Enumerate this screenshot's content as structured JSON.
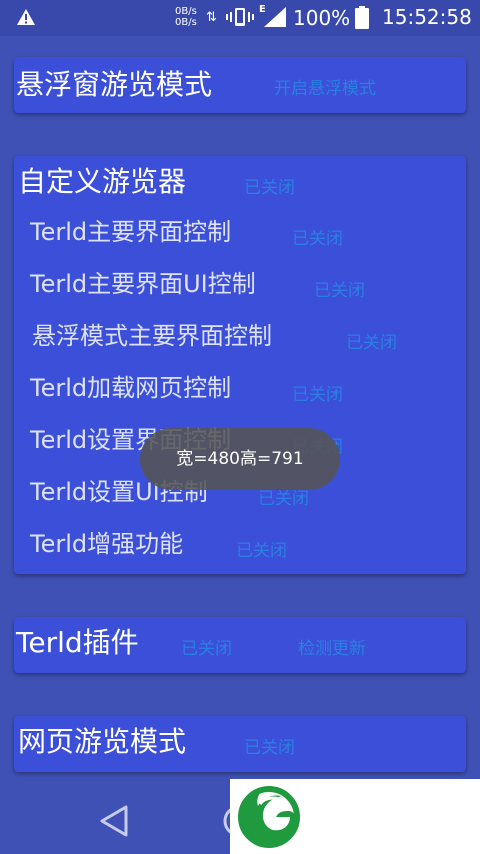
{
  "status_bar": {
    "net_up": "0B/s",
    "net_down": "0B/s",
    "network_type": "E",
    "battery_percent": "100%",
    "time": "15:52:58",
    "icons": [
      "warning-icon",
      "data-arrows-icon",
      "vibrate-icon",
      "signal-icon",
      "battery-icon"
    ]
  },
  "cards": {
    "floating": {
      "title": "悬浮窗游览模式",
      "action": "开启悬浮模式"
    },
    "custom": {
      "title": "自定义游览器",
      "status": "已关闭",
      "items": [
        {
          "label": "Terld主要界面控制",
          "status": "已关闭"
        },
        {
          "label": "Terld主要界面UI控制",
          "status": "已关闭"
        },
        {
          "label": "悬浮模式主要界面控制",
          "status": "已关闭"
        },
        {
          "label": "Terld加载网页控制",
          "status": "已关闭"
        },
        {
          "label": "Terld设置界面控制",
          "status": "已关闭"
        },
        {
          "label": "Terld设置UI控制",
          "status": "已关闭"
        },
        {
          "label": "Terld增强功能",
          "status": "已关闭"
        }
      ]
    },
    "plugin": {
      "title": "Terld插件",
      "status": "已关闭",
      "action": "检测更新"
    },
    "web": {
      "title": "网页游览模式",
      "status": "已关闭"
    }
  },
  "toast": {
    "text": "宽=480高=791"
  },
  "nav_bar": {
    "icons": [
      "back-icon",
      "home-icon"
    ]
  },
  "overlay_logo": {
    "icon": "green-leaf-g-logo"
  },
  "colors": {
    "background": "#3F51B5",
    "card": "#3B4FD8",
    "status_text": "#2B7FE4",
    "logo_green": "#1F9A3E"
  }
}
